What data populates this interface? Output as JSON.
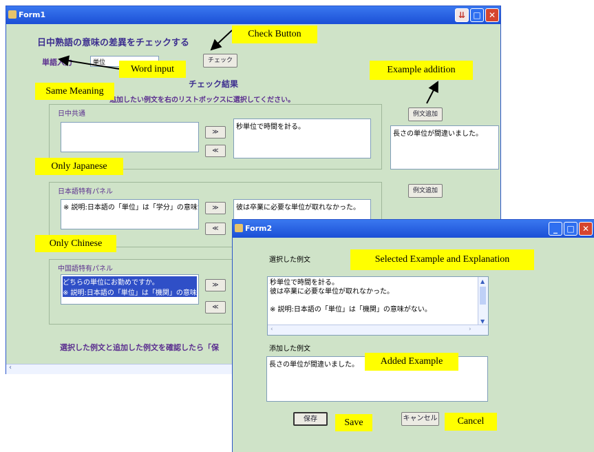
{
  "form1": {
    "title": "Form1",
    "heading": "日中熟語の意味の差異をチェックする",
    "word_label": "単語入力",
    "word_value": "単位",
    "check_button": "チェック",
    "result_label": "チェック結果",
    "instruction": "追加したい例文を右のリストボックスに選択してください。",
    "panel1_title": "日中共通",
    "panel1_right": "秒単位で時間を計る。",
    "panel2_title": "日本語特有パネル",
    "panel2_left": "※ 説明:日本語の「単位」は「学分」の意味がある。",
    "panel2_right": "彼は卒業に必要な単位が取れなかった。",
    "panel3_title": "中国語特有パネル",
    "panel3_left1": "どちらの単位にお勤めですか。",
    "panel3_left2": "※ 説明:日本語の「単位」は「機関」の意味がない。",
    "move_right": "≫",
    "move_left": "≪",
    "example_add_1": "例文追加",
    "example_add_2": "例文追加",
    "right_list": "長さの単位が間違いました。",
    "footer": "選択した例文と追加した例文を確認したら「保"
  },
  "form2": {
    "title": "Form2",
    "selected_label": "選択した例文",
    "selected_lines": [
      "秒単位で時間を計る。",
      "彼は卒業に必要な単位が取れなかった。",
      "",
      "※ 説明:日本語の「単位」は「機関」の意味がない。"
    ],
    "added_label": "添加した例文",
    "added_text": "長さの単位が間違いました。",
    "save_button": "保存",
    "cancel_button": "キャンセル"
  },
  "annotations": {
    "check_button": "Check Button",
    "word_input": "Word input",
    "example_addition": "Example addition",
    "same_meaning": "Same Meaning",
    "only_japanese": "Only Japanese",
    "only_chinese": "Only Chinese",
    "selected_explanation": "Selected Example and Explanation",
    "added_example": "Added Example",
    "save": "Save",
    "cancel": "Cancel"
  },
  "colors": {
    "window_bg": "#cfe3c8",
    "titlebar": "#1b4fd6",
    "annotation": "#ffff00"
  }
}
